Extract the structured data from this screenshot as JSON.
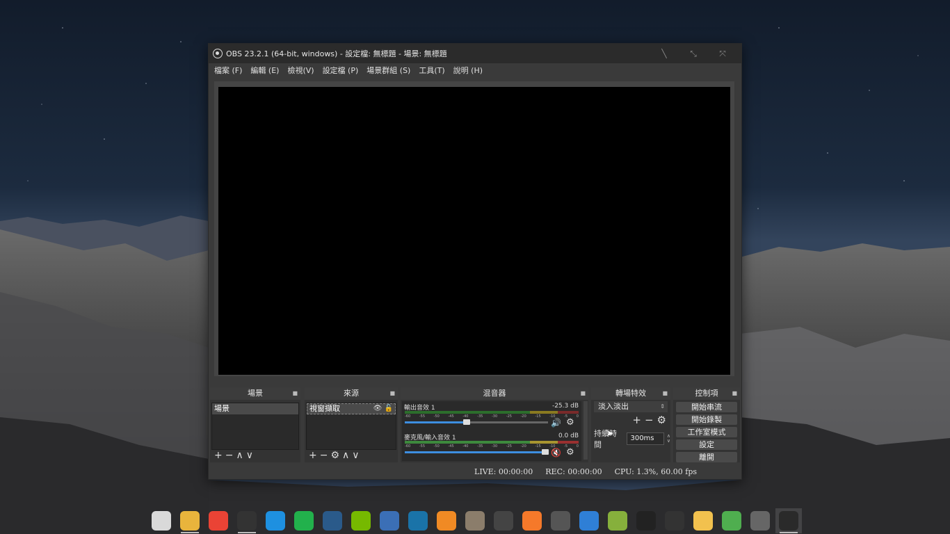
{
  "window": {
    "title": "OBS 23.2.1 (64-bit, windows) - 設定檔: 無標題 - 場景: 無標題",
    "controls": [
      "minimize",
      "maximize",
      "close"
    ]
  },
  "menu": [
    "檔案 (F)",
    "編輯 (E)",
    "檢視(V)",
    "設定檔 (P)",
    "場景群組 (S)",
    "工具(T)",
    "說明 (H)"
  ],
  "docks": {
    "scenes": {
      "title": "場景",
      "items": [
        "場景"
      ]
    },
    "sources": {
      "title": "來源",
      "items": [
        "視窗擷取"
      ]
    },
    "mixer": {
      "title": "混音器",
      "tracks": [
        {
          "name": "輸出音效 1",
          "db": "-25.3 dB",
          "level": 0.43,
          "muted": false
        },
        {
          "name": "麥克風/輸入音效 1",
          "db": "0.0 dB",
          "level": 0.98,
          "muted": true
        }
      ],
      "ticks": [
        "-60",
        "-55",
        "-50",
        "-45",
        "-40",
        "-35",
        "-30",
        "-25",
        "-20",
        "-15",
        "-10",
        "-5",
        "0"
      ]
    },
    "transitions": {
      "title": "轉場特效",
      "selected": "淡入淡出",
      "duration_label": "持續時間",
      "duration": "300ms"
    },
    "controls": {
      "title": "控制項",
      "buttons": [
        "開始串流",
        "開始錄製",
        "工作室模式",
        "設定",
        "離開"
      ]
    }
  },
  "status": {
    "live": "LIVE: 00:00:00",
    "rec": "REC: 00:00:00",
    "cpu": "CPU: 1.3%, 60.00 fps"
  },
  "taskbar": [
    {
      "name": "recycle-bin",
      "color": "#d9d9d9"
    },
    {
      "name": "file-manager",
      "color": "#e9b43c"
    },
    {
      "name": "chrome",
      "color": "#ea4335"
    },
    {
      "name": "music-player",
      "color": "#333333"
    },
    {
      "name": "skype",
      "color": "#1e90e0"
    },
    {
      "name": "line",
      "color": "#22b14c"
    },
    {
      "name": "steam",
      "color": "#2a5a8a"
    },
    {
      "name": "nvidia",
      "color": "#76b900"
    },
    {
      "name": "layers-app",
      "color": "#3b6fb6"
    },
    {
      "name": "inkscape-drop",
      "color": "#1a73a8"
    },
    {
      "name": "firefox-like",
      "color": "#f08a24"
    },
    {
      "name": "gimp",
      "color": "#8b7d6b"
    },
    {
      "name": "inkscape",
      "color": "#444444"
    },
    {
      "name": "blender",
      "color": "#f5792a"
    },
    {
      "name": "video-editor",
      "color": "#555555"
    },
    {
      "name": "audio-app",
      "color": "#2f7fd6"
    },
    {
      "name": "game-app",
      "color": "#86b03c"
    },
    {
      "name": "piano",
      "color": "#222222"
    },
    {
      "name": "calculator",
      "color": "#333333"
    },
    {
      "name": "notes",
      "color": "#f2c14e"
    },
    {
      "name": "money-app",
      "color": "#4fae4f"
    },
    {
      "name": "editor-app",
      "color": "#666666"
    },
    {
      "name": "obs",
      "color": "#2a2a2a"
    }
  ]
}
